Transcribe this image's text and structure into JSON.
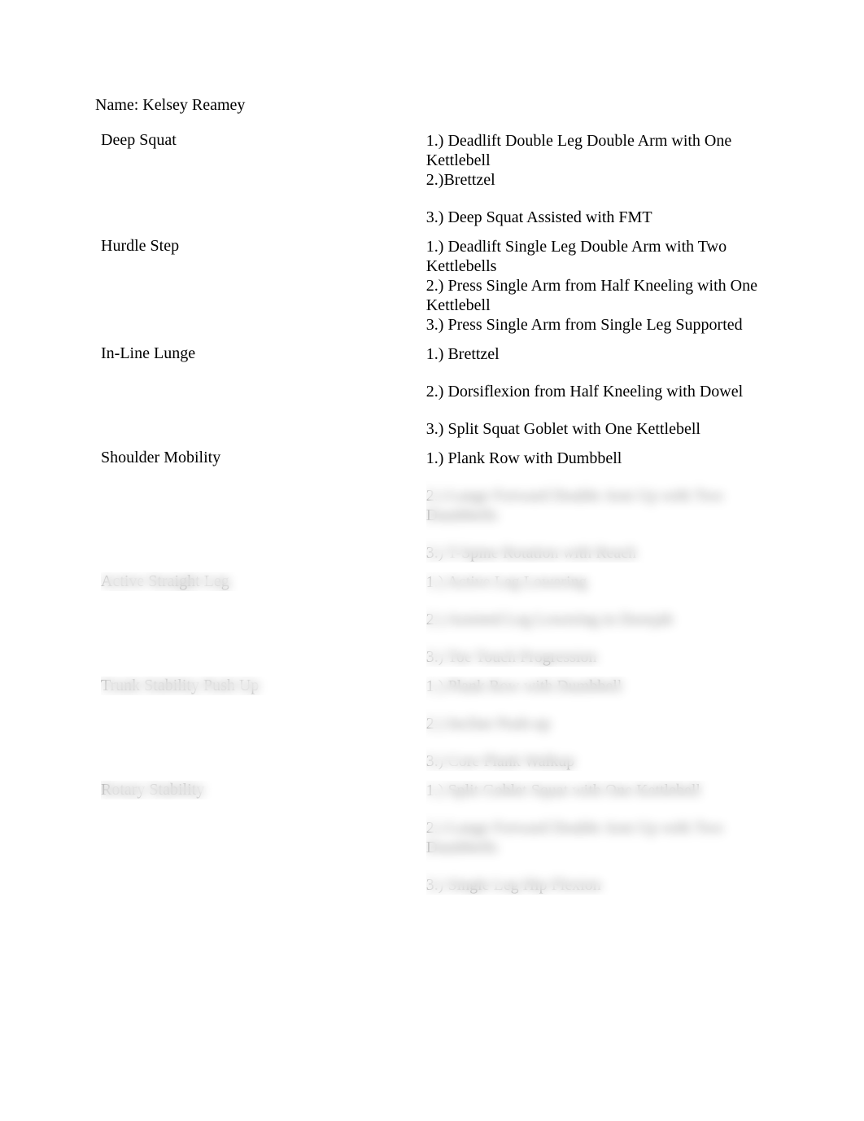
{
  "name_line": "Name: Kelsey Reamey",
  "rows": [
    {
      "label": "Deep Squat",
      "lines": [
        "1.) Deadlift Double Leg Double Arm with One Kettlebell",
        "2.)Brettzel",
        "",
        "3.) Deep Squat Assisted with FMT"
      ],
      "blurred": false
    },
    {
      "label": "Hurdle Step",
      "lines": [
        "1.) Deadlift Single Leg Double Arm with Two Kettlebells",
        "2.) Press Single Arm from Half Kneeling with One Kettlebell",
        "3.) Press Single Arm from Single Leg Supported"
      ],
      "blurred": false
    },
    {
      "label": "In-Line Lunge",
      "lines": [
        "1.) Brettzel",
        "",
        "2.) Dorsiflexion from Half Kneeling with Dowel",
        "",
        "3.) Split Squat Goblet with One Kettlebell"
      ],
      "blurred": false
    },
    {
      "label": "Shoulder Mobility",
      "lines": [
        "1.) Plank Row with Dumbbell"
      ],
      "blurred_lines": [
        "2.) Lunge Forward Double Arm Up with Two Dumbbells",
        "",
        "3.) T-Spine Rotation with Reach"
      ],
      "blurred": "partial"
    },
    {
      "label": "Active Straight Leg",
      "lines": [
        "1.) Active Leg Lowering",
        "",
        "2.) Assisted Leg Lowering in Doorjab",
        "",
        "3.) Toe Touch Progression"
      ],
      "blurred": true
    },
    {
      "label": "Trunk Stability Push Up",
      "lines": [
        "1.) Plank Row with Dumbbell",
        "",
        "2.) Incline Push-up",
        "",
        "3.) Core Plank Walkup"
      ],
      "blurred": true
    },
    {
      "label": "Rotary Stability",
      "lines": [
        "1.) Split Goblet Squat with One Kettlebell",
        "",
        "2.) Lunge Forward Double Arm Up with Two Dumbbells",
        "",
        "3.) Single Leg Hip Flexion"
      ],
      "blurred": true
    }
  ]
}
